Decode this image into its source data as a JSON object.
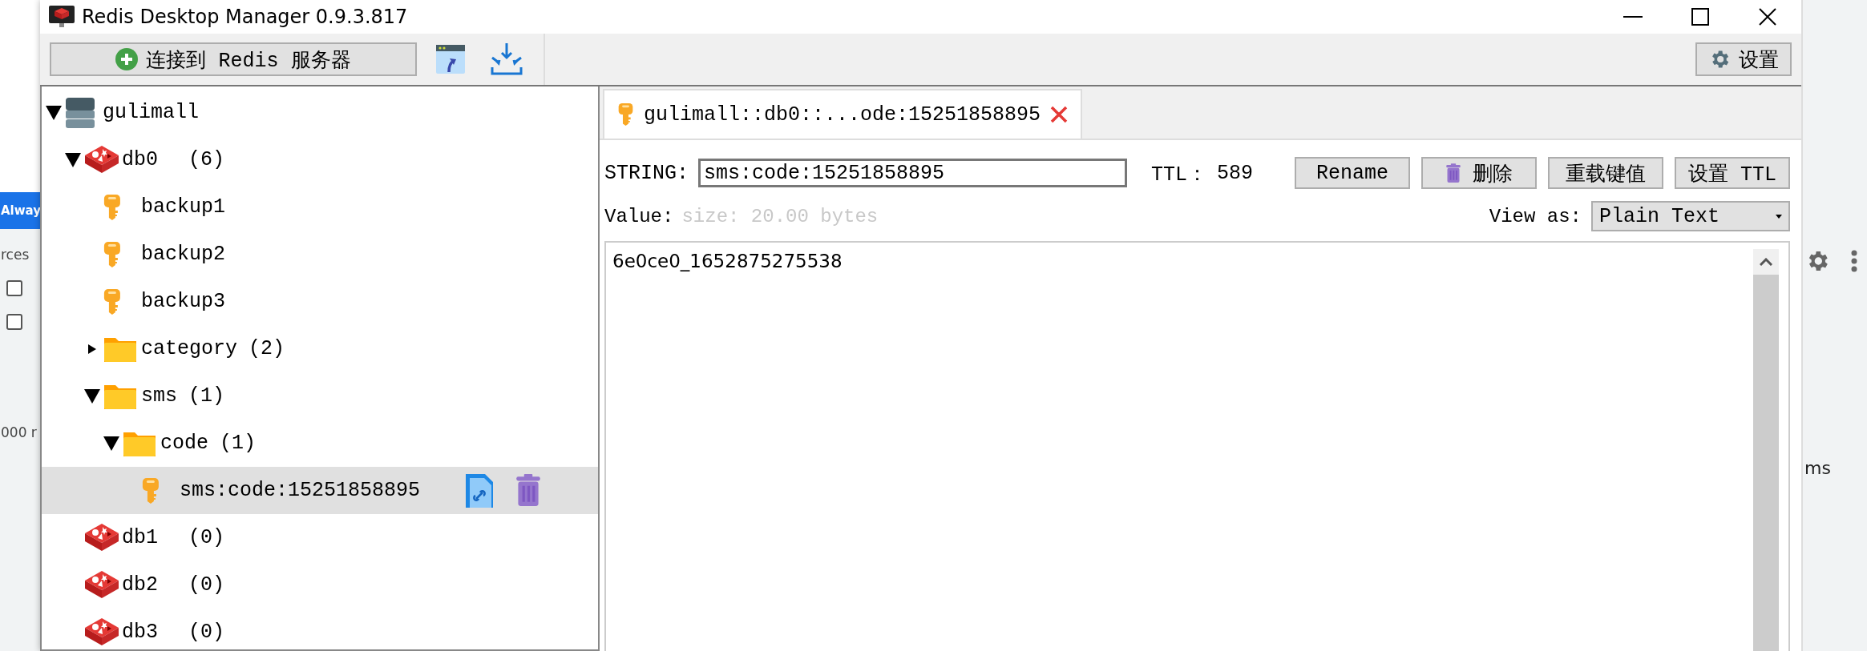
{
  "window": {
    "title": "Redis Desktop Manager 0.9.3.817"
  },
  "toolbar": {
    "connect_button": "连接到 Redis 服务器",
    "settings_button": "设置"
  },
  "tree": [
    {
      "kind": "server",
      "name": "gulimall",
      "expanded": true,
      "selected": false,
      "children": [
        {
          "kind": "db",
          "name": "db0",
          "count": "(6)",
          "expanded": true,
          "selected": false,
          "children": [
            {
              "kind": "key",
              "name": "backup1",
              "selected": false
            },
            {
              "kind": "key",
              "name": "backup2",
              "selected": false
            },
            {
              "kind": "key",
              "name": "backup3",
              "selected": false
            },
            {
              "kind": "folder",
              "name": "category",
              "count": "(2)",
              "expanded": false,
              "selected": false
            },
            {
              "kind": "folder",
              "name": "sms",
              "count": "(1)",
              "expanded": true,
              "selected": false,
              "children": [
                {
                  "kind": "folder",
                  "name": "code",
                  "count": "(1)",
                  "expanded": true,
                  "selected": false,
                  "children": [
                    {
                      "kind": "key",
                      "name": "sms:code:15251858895",
                      "selected": true
                    }
                  ]
                }
              ]
            }
          ]
        },
        {
          "kind": "db",
          "name": "db1",
          "count": "(0)",
          "selected": false
        },
        {
          "kind": "db",
          "name": "db2",
          "count": "(0)",
          "selected": false
        },
        {
          "kind": "db",
          "name": "db3",
          "count": "(0)",
          "selected": false
        }
      ]
    }
  ],
  "editor": {
    "tabs": [
      {
        "label": "gulimall::db0::...ode:15251858895",
        "selected": true
      }
    ],
    "key_type": "STRING:",
    "key_name": "sms:code:15251858895",
    "ttl_label": "TTL：",
    "ttl": "589",
    "buttons": [
      {
        "label": "Rename",
        "kind": "plain"
      },
      {
        "label": "删除",
        "kind": "delete"
      },
      {
        "label": "重载键值",
        "kind": "plain"
      },
      {
        "label": "设置 TTL",
        "kind": "plain"
      }
    ],
    "value_label": "Value:",
    "size": "size: 20.00 bytes",
    "view_as_label": "View as:",
    "view_as": "Plain Text",
    "value": "6e0ce0_1652875275538"
  },
  "background_window": {
    "button": "Alway",
    "tab": "rces",
    "checkboxes": [
      {
        "checked": false
      },
      {
        "checked": false
      }
    ],
    "cell": "000 r",
    "right_cell": "ms"
  }
}
